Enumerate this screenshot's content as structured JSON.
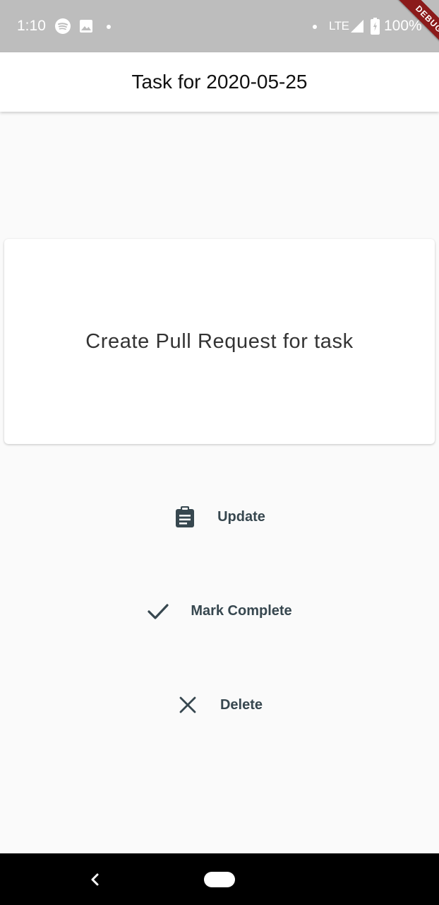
{
  "status_bar": {
    "time": "1:10",
    "network": "LTE",
    "battery": "100%",
    "icons": [
      "spotify-icon",
      "image-icon",
      "notification-dot-icon",
      "dot-icon",
      "signal-icon",
      "battery-icon"
    ]
  },
  "debug_banner": "DEBUG",
  "app_bar": {
    "title": "Task for 2020-05-25"
  },
  "task": {
    "text": "Create Pull Request for task"
  },
  "actions": [
    {
      "label": "Update",
      "icon": "clipboard-icon"
    },
    {
      "label": "Mark Complete",
      "icon": "check-icon"
    },
    {
      "label": "Delete",
      "icon": "close-icon"
    }
  ],
  "navigation": {
    "icons": [
      "back-icon",
      "home-pill-icon"
    ]
  },
  "colors": {
    "status_bar": "#bdbdbd",
    "background": "#fafafa",
    "action_text": "#37474f",
    "debug_ribbon": "#8b1a1a"
  }
}
